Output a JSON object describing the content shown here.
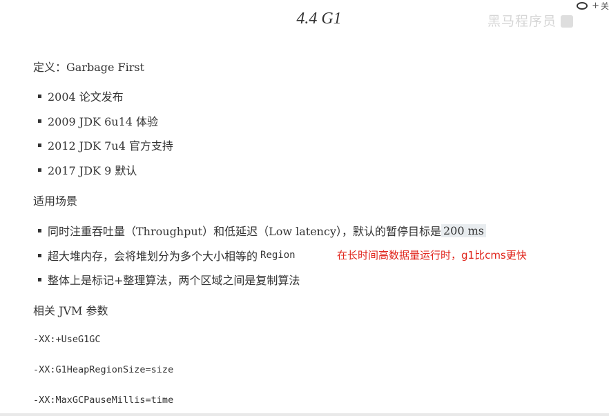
{
  "doc": {
    "title": "4.4 G1",
    "definition": "定义：Garbage First",
    "history": [
      "2004 论文发布",
      "2009 JDK 6u14 体验",
      "2012 JDK 7u4 官方支持",
      "2017 JDK 9 默认"
    ],
    "scenarios_heading": "适用场景",
    "scenarios": {
      "item1_text": "同时注重吞吐量（Throughput）和低延迟（Low latency），默认的暂停目标是",
      "item1_highlight": "200 ms",
      "item2_text": "超大堆内存，会将堆划分为多个大小相等的",
      "item2_code": "Region",
      "item3_text": "整体上是标记+整理算法，两个区域之间是复制算法"
    },
    "annotation": "在长时间高数据量运行时，g1比cms更快",
    "jvm_heading": "相关 JVM 参数",
    "jvm_params": [
      "-XX:+UseG1GC",
      "-XX:G1HeapRegionSize=size",
      "-XX:MaxGCPauseMillis=time"
    ]
  },
  "overlay": {
    "close_label": "关",
    "plus": "+",
    "watermark": "黑马程序员"
  }
}
